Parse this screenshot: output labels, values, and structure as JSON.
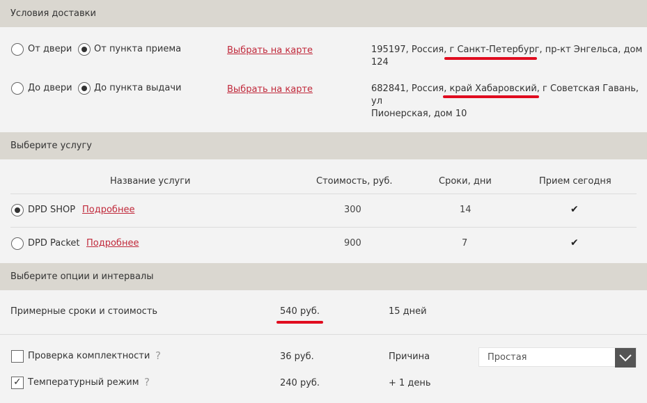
{
  "delivery": {
    "header": "Условия доставки",
    "from_door": "От двери",
    "from_point": "От пункта приема",
    "to_door": "До двери",
    "to_point": "До пункта выдачи",
    "map_link_1": "Выбрать на карте",
    "map_link_2": "Выбрать на карте",
    "addr1_line1": "195197, Россия, г Санкт-Петербург, пр-кт Энгельса, дом",
    "addr1_line2": "124",
    "addr2_line1": "682841, Россия, край Хабаровский, г Советская Гавань, ул",
    "addr2_line2": "Пионерская, дом 10"
  },
  "service": {
    "header": "Выберите услугу",
    "columns": [
      "Название услуги",
      "Стоимость, руб.",
      "Сроки, дни",
      "Прием сегодня"
    ],
    "rows": [
      {
        "name": "DPD SHOP",
        "more": "Подробнее",
        "cost": "300",
        "days": "14",
        "today": "✔"
      },
      {
        "name": "DPD Packet",
        "more": "Подробнее",
        "cost": "900",
        "days": "7",
        "today": "✔"
      }
    ]
  },
  "options": {
    "header": "Выберите опции и интервалы",
    "estimate_label": "Примерные сроки и стоимость",
    "estimate_cost": "540 руб.",
    "estimate_days": "15 дней",
    "opt1_label": "Проверка комплектности",
    "opt1_price": "36 руб.",
    "opt1_reason_label": "Причина",
    "opt1_select_value": "Простая",
    "opt2_label": "Температурный режим",
    "opt2_price": "240 руб.",
    "opt2_extra": "+ 1 день",
    "question_mark": "?",
    "checkmark": "✓"
  },
  "colors": {
    "header_bg": "#dad7d0",
    "link": "#c0283a",
    "highlight": "#e00c1f"
  }
}
